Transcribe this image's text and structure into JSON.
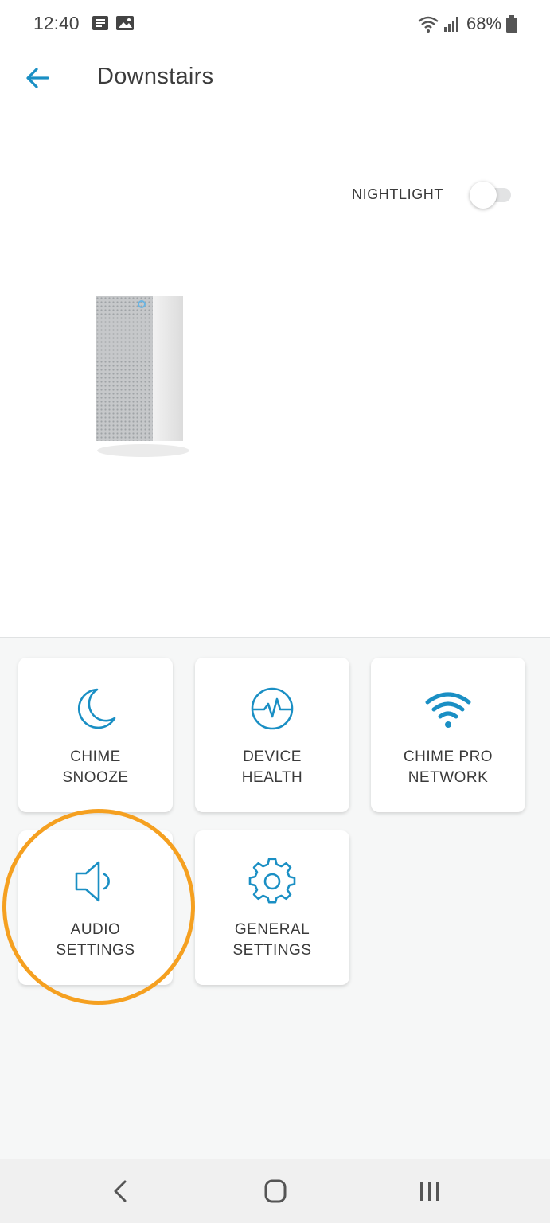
{
  "status_bar": {
    "time": "12:40",
    "battery_percent": "68%",
    "icons": [
      "notification-icon",
      "photo-icon",
      "wifi-icon",
      "signal-icon",
      "battery-icon"
    ]
  },
  "header": {
    "back_icon": "arrow-left-icon",
    "title": "Downstairs"
  },
  "nightlight": {
    "label": "NIGHTLIGHT",
    "enabled": false
  },
  "tiles": [
    {
      "line1": "CHIME",
      "line2": "SNOOZE",
      "icon": "moon-icon"
    },
    {
      "line1": "DEVICE",
      "line2": "HEALTH",
      "icon": "pulse-icon"
    },
    {
      "line1": "CHIME PRO",
      "line2": "NETWORK",
      "icon": "wifi-icon"
    },
    {
      "line1": "AUDIO",
      "line2": "SETTINGS",
      "icon": "speaker-icon"
    },
    {
      "line1": "GENERAL",
      "line2": "SETTINGS",
      "icon": "gear-icon"
    }
  ],
  "colors": {
    "accent": "#1a8fc4",
    "highlight": "#f5a020",
    "panel_bg": "#f6f7f7"
  },
  "nav_bar": {
    "icons": [
      "nav-back-icon",
      "nav-home-icon",
      "nav-recents-icon"
    ]
  }
}
